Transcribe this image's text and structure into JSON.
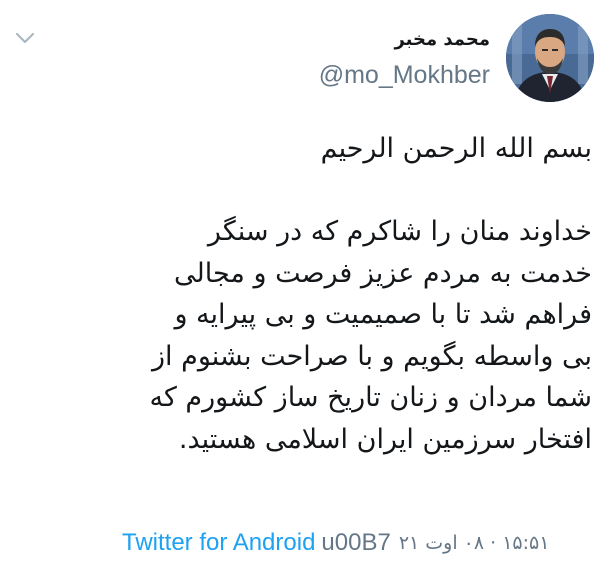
{
  "tweet": {
    "display_name": "محمد مخبر",
    "handle": "@mo_Mokhber",
    "avatar_icon": "profile-photo",
    "menu_icon": "chevron-down-icon",
    "body_lines": [
      "بسم الله الرحمن الرحیم",
      "",
      "خداوند منان را شاکرم که در سنگر",
      "خدمت به مردم عزیز فرصت و مجالی",
      "فراهم شد تا با صمیمیت و بی پیرایه و",
      "بی واسطه بگویم و با صراحت بشنوم از",
      "شما مردان و زنان تاریخ ساز کشورم که",
      "افتخار سرزمین ایران اسلامی هستید."
    ],
    "source_label": "Twitter for Android",
    "separator": "u00B7",
    "timestamp": "۱۵:۵۱ · ۰۸ اوت ۲۱"
  },
  "colors": {
    "link": "#1da1f2",
    "muted": "#657786",
    "text": "#14171a",
    "background": "#ffffff"
  }
}
